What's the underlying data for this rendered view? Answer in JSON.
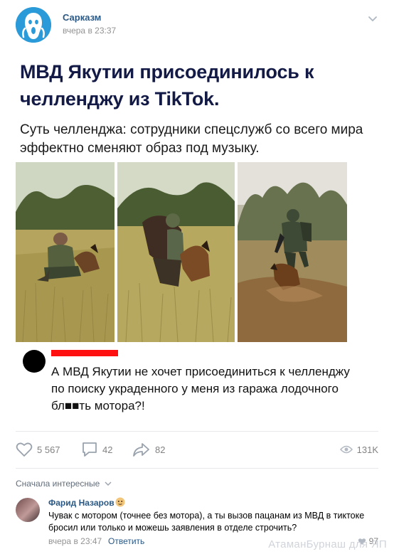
{
  "post": {
    "author": "Сарказм",
    "time": "вчера в 23:37",
    "headline": "МВД Якутии присоединилось к челленджу из TikTok.",
    "subline": "Суть челленджа: сотрудники спецслужб со всего мира эффектно сменяют образ под музыку.",
    "quote": "А МВД Якутии не хочет присоединиться к челленджу по поиску украденного у меня из гаража лодочного бл■■ть мотора?!",
    "likes": "5 567",
    "comments": "42",
    "shares": "82",
    "views": "131K"
  },
  "comments_section": {
    "sort_label": "Сначала интересные",
    "items": [
      {
        "name": "Фарид Назаров",
        "text": "Чувак с мотором (точнее без мотора), а ты вызов пацанам из МВД в тиктоке бросил или только и можешь заявления в отделе строчить?",
        "time": "вчера в 23:47",
        "reply_label": "Ответить",
        "likes": "97"
      }
    ]
  },
  "watermark": "АтаманБурнаш для ЯП",
  "icons": [
    "heart-icon",
    "comment-icon",
    "share-icon",
    "eye-icon",
    "chevron-down-icon",
    "scream-avatar-icon"
  ],
  "colors": {
    "link": "#2a5885",
    "headline": "#121a45",
    "meta": "#939393",
    "redbar": "#ff1010"
  }
}
